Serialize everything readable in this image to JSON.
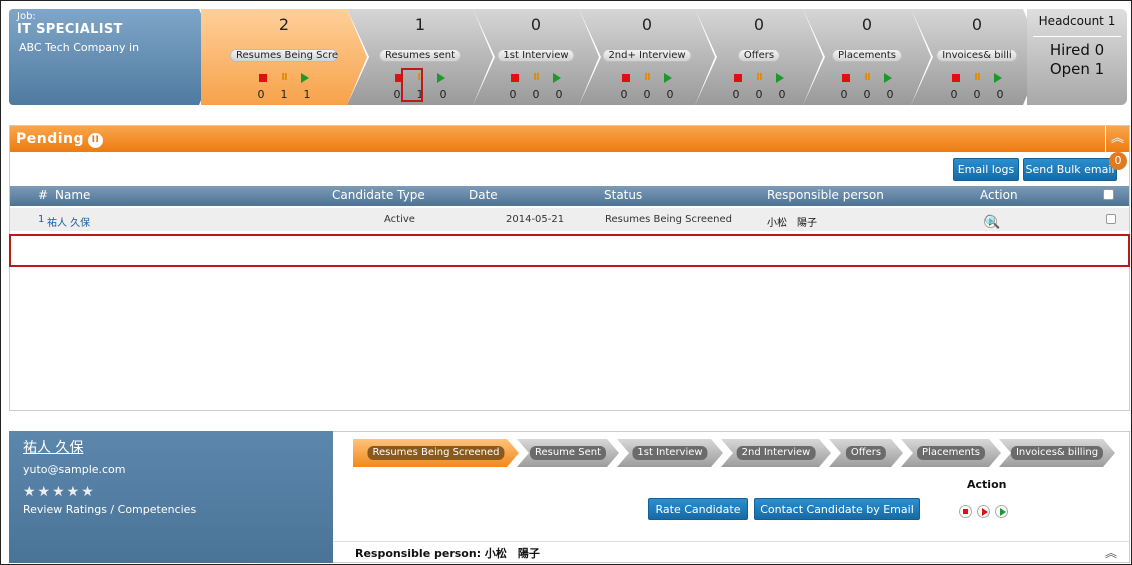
{
  "job": {
    "label": "Job:",
    "title": "IT SPECIALIST",
    "company": "ABC Tech Company in"
  },
  "stages": [
    {
      "count": "2",
      "label": "Resumes Being Scree",
      "n1": "0",
      "n2": "1",
      "n3": "1"
    },
    {
      "count": "1",
      "label": "Resumes sent",
      "n1": "0",
      "n2": "1",
      "n3": "0"
    },
    {
      "count": "0",
      "label": "1st Interview",
      "n1": "0",
      "n2": "0",
      "n3": "0"
    },
    {
      "count": "0",
      "label": "2nd+ Interview",
      "n1": "0",
      "n2": "0",
      "n3": "0"
    },
    {
      "count": "0",
      "label": "Offers",
      "n1": "0",
      "n2": "0",
      "n3": "0"
    },
    {
      "count": "0",
      "label": "Placements",
      "n1": "0",
      "n2": "0",
      "n3": "0"
    },
    {
      "count": "0",
      "label": "Invoices& billi",
      "n1": "0",
      "n2": "0",
      "n3": "0"
    }
  ],
  "headcount": {
    "label": "Headcount 1",
    "hired": "Hired 0",
    "open": "Open 1"
  },
  "pending": {
    "title": "Pending",
    "email_logs": "Email logs",
    "send_bulk": "Send Bulk email",
    "badge": "0"
  },
  "table": {
    "headers": {
      "num": "#",
      "name": "Name",
      "type": "Candidate Type",
      "date": "Date",
      "status": "Status",
      "resp": "Responsible person",
      "action": "Action"
    },
    "rows": [
      {
        "num": "1",
        "name": "祐人 久保",
        "type": "Active",
        "date": "2014-05-21",
        "status": "Resumes Being Screened",
        "resp": "小松　陽子"
      }
    ]
  },
  "candidate": {
    "name": "祐人 久保",
    "email": "yuto@sample.com",
    "stars": "★★★★★",
    "review": "Review Ratings / Competencies"
  },
  "pipeline": [
    "Resumes Being Screened",
    "Resume Sent",
    "1st Interview",
    "2nd Interview",
    "Offers",
    "Placements",
    "Invoices& billing"
  ],
  "detail": {
    "rate": "Rate Candidate",
    "contact": "Contact Candidate by Email",
    "action": "Action",
    "responsible": "Responsible person: 小松　陽子"
  },
  "colors": {
    "accent_orange": "#ef7a10",
    "header_blue": "#4d7294",
    "button_blue": "#1d7bbd"
  }
}
